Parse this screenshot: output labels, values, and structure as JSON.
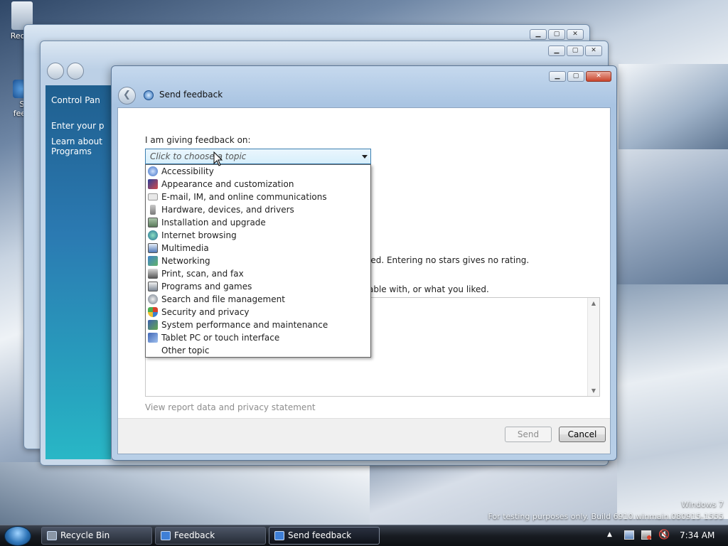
{
  "desktop": {
    "icons": [
      {
        "label": "Recyc"
      },
      {
        "label": "S\nfeed"
      }
    ],
    "watermark_line1": "Windows 7",
    "watermark_line2": "For testing purposes only. Build 6910.winmain.080915-1555"
  },
  "bg_window_cp": {
    "title": "Control Pan",
    "links": [
      "Enter your p",
      "Learn about",
      "Programs"
    ]
  },
  "dialog": {
    "title": "Send feedback",
    "feedback_on_label": "I am giving feedback on:",
    "combo_placeholder": "Click to choose a topic",
    "topics": [
      {
        "label": "Accessibility",
        "icon": "accessibility-icon",
        "color": "#3b6fc7"
      },
      {
        "label": "Appearance and customization",
        "icon": "appearance-icon",
        "color": "#2a3f9a"
      },
      {
        "label": "E-mail, IM, and online communications",
        "icon": "email-icon",
        "color": "#d9d9d9"
      },
      {
        "label": "Hardware, devices, and drivers",
        "icon": "hardware-icon",
        "color": "#8a8a8a"
      },
      {
        "label": "Installation and upgrade",
        "icon": "installation-icon",
        "color": "#6d8f6f"
      },
      {
        "label": "Internet browsing",
        "icon": "globe-icon",
        "color": "#2f8f7a"
      },
      {
        "label": "Multimedia",
        "icon": "multimedia-icon",
        "color": "#4f79b8"
      },
      {
        "label": "Networking",
        "icon": "network-icon",
        "color": "#3f82c9"
      },
      {
        "label": "Print, scan, and fax",
        "icon": "printer-icon",
        "color": "#5c5c5c"
      },
      {
        "label": "Programs and games",
        "icon": "programs-icon",
        "color": "#7c8795"
      },
      {
        "label": "Search and file management",
        "icon": "search-icon",
        "color": "#6f7b8a"
      },
      {
        "label": "Security and privacy",
        "icon": "shield-icon",
        "color": "#d9402a"
      },
      {
        "label": "System performance and maintenance",
        "icon": "system-icon",
        "color": "#3d5fb0"
      },
      {
        "label": "Tablet PC or touch interface",
        "icon": "tablet-icon",
        "color": "#4066b5"
      },
      {
        "label": "Other topic",
        "icon": "",
        "color": ""
      }
    ],
    "rating_text_partial": "ied.  Entering no stars gives no rating.",
    "comments_text_partial": "able with, or what you liked.",
    "privacy_link": "View report data and privacy statement",
    "send_label": "Send",
    "cancel_label": "Cancel"
  },
  "taskbar": {
    "items": [
      {
        "label": "Recycle Bin"
      },
      {
        "label": "Feedback"
      },
      {
        "label": "Send feedback"
      }
    ],
    "clock": "7:34 AM"
  },
  "colors": {
    "accent": "#3c7fb1",
    "link_gray": "#8d8d8d"
  }
}
